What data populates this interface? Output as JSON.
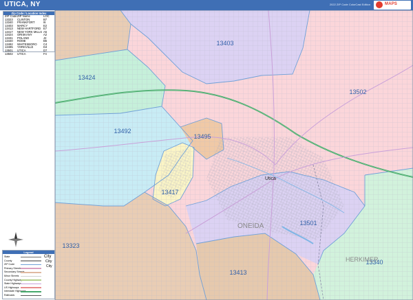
{
  "header": {
    "title": "UTICA, NY",
    "edition": "2022 ZIP Code ColorCast Edition",
    "logo_text": "MAPS"
  },
  "zip_index": {
    "title": "Zip Code / Location Index",
    "columns": [
      "ZIP Code",
      "ZIP Name",
      "LOC"
    ],
    "rows": [
      [
        "13323",
        "CLINTON",
        "B7"
      ],
      [
        "13340",
        "FRANKFORT",
        "I6"
      ],
      [
        "13403",
        "MARCY",
        "E2"
      ],
      [
        "13413",
        "NEW HARTFORD",
        "E7"
      ],
      [
        "13417",
        "NEW YORK MILLS",
        "A5"
      ],
      [
        "13424",
        "ORISKANY",
        "A2"
      ],
      [
        "13431",
        "POLAND",
        "J2"
      ],
      [
        "13440",
        "ROME",
        "B5"
      ],
      [
        "13492",
        "WHITESBORO",
        "C4"
      ],
      [
        "13495",
        "YORKVILLE",
        "D4"
      ],
      [
        "13501",
        "UTICA",
        "D7"
      ],
      [
        "13502",
        "UTICA",
        "F4"
      ]
    ]
  },
  "zip_labels": {
    "z13403": "13403",
    "z13424": "13424",
    "z13502": "13502",
    "z13492": "13492",
    "z13495": "13495",
    "z13417": "13417",
    "z13501": "13501",
    "z13323": "13323",
    "z13413": "13413",
    "z13340": "13340"
  },
  "places": {
    "utica": "Utica",
    "oneida": "ONEIDA",
    "herkimer": "HERKIMER"
  },
  "legend": {
    "title": "Legend",
    "items": [
      "State",
      "County",
      "ZIP Code",
      "Primary Streets",
      "Secondary Streets",
      "Minor Streets",
      "County Highways",
      "State Highways",
      "US Highways",
      "Interstate Highways",
      "Railroads"
    ],
    "city_samples": [
      "City",
      "City",
      "City"
    ]
  },
  "colors": {
    "title_bar": "#3f6fb5",
    "zip_label": "#2f5fa8",
    "zone_pink": "#fbd6da",
    "zone_violet": "#dcd2f3",
    "zone_green": "#c6f0da",
    "zone_cyan": "#c8ecf5",
    "zone_tan": "#e9cdb4",
    "zone_yellow": "#fbf5c6",
    "zone_mint": "#d2f2dc",
    "interstate": "#45a86a",
    "boundary": "#6fa0d8"
  }
}
